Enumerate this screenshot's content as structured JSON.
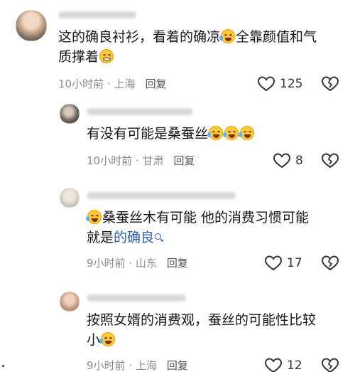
{
  "comments": [
    {
      "text_parts": [
        "这的确良衬衫，看着的确凉",
        "全靠颜值和气",
        "质撑着"
      ],
      "meta": {
        "time": "10小时前",
        "location": "上海",
        "reply": "回复"
      },
      "likes": "125"
    },
    {
      "text_parts": [
        "有没有可能是桑蚕丝"
      ],
      "meta": {
        "time": "10小时前",
        "location": "甘肃",
        "reply": "回复"
      },
      "likes": "8"
    },
    {
      "text_parts": [
        "桑蚕丝木有可能 他的消费习惯可能",
        "就是",
        "的确良"
      ],
      "meta": {
        "time": "9小时前",
        "location": "山东",
        "reply": "回复"
      },
      "likes": "17"
    },
    {
      "text_parts": [
        "按照女婿的消费观，蚕丝的可能性比较",
        "小"
      ],
      "meta": {
        "time": "9小时前",
        "location": "上海",
        "reply": "回复"
      },
      "likes": "12"
    }
  ],
  "meta_separator": "·",
  "icons": {
    "like": "heart-outline-icon",
    "dislike": "broken-heart-icon",
    "mention_search": "search-icon",
    "emoji_laugh_cry": "laugh-cry-emoji-icon",
    "emoji_grin": "grin-emoji-icon"
  },
  "colors": {
    "text": "#161616",
    "meta": "#8a8a8a",
    "mention": "#2a5db0",
    "background": "#ffffff"
  }
}
